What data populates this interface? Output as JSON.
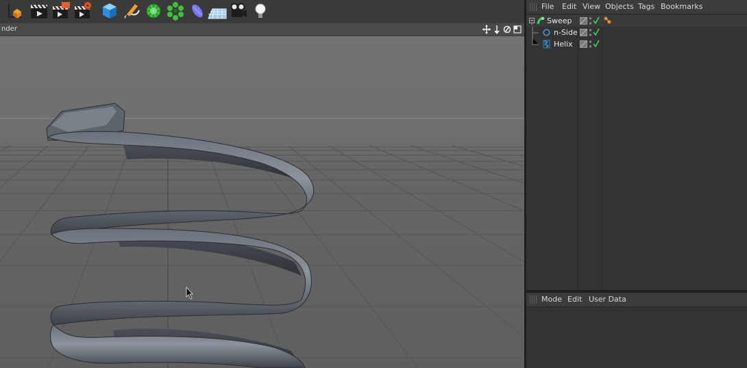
{
  "toolbar": {
    "tools": [
      {
        "name": "axis-tool-icon"
      },
      {
        "name": "render-view-icon"
      },
      {
        "name": "render-to-picture-viewer-icon"
      },
      {
        "name": "render-settings-icon"
      },
      {
        "name": "cube-primitive-icon"
      },
      {
        "name": "pen-spline-icon"
      },
      {
        "name": "subdivision-generator-icon"
      },
      {
        "name": "array-generator-icon"
      },
      {
        "name": "deformer-icon"
      },
      {
        "name": "floor-environment-icon"
      },
      {
        "name": "camera-icon"
      },
      {
        "name": "light-icon"
      }
    ]
  },
  "viewport": {
    "title": "nder"
  },
  "object_manager": {
    "menu": [
      "File",
      "Edit",
      "View",
      "Objects",
      "Tags",
      "Bookmarks"
    ],
    "objects": [
      {
        "name": "Sweep",
        "icon": "sweep-icon",
        "level": 0
      },
      {
        "name": "n-Side",
        "icon": "n-side-icon",
        "level": 1
      },
      {
        "name": "Helix",
        "icon": "helix-icon",
        "level": 1
      }
    ]
  },
  "attribute_manager": {
    "menu": [
      "Mode",
      "Edit",
      "User Data"
    ]
  },
  "colors": {
    "enabled_check": "#3fd15a",
    "selection_accent": "#e08a2a",
    "helix_icon": "#3b8fe0"
  }
}
